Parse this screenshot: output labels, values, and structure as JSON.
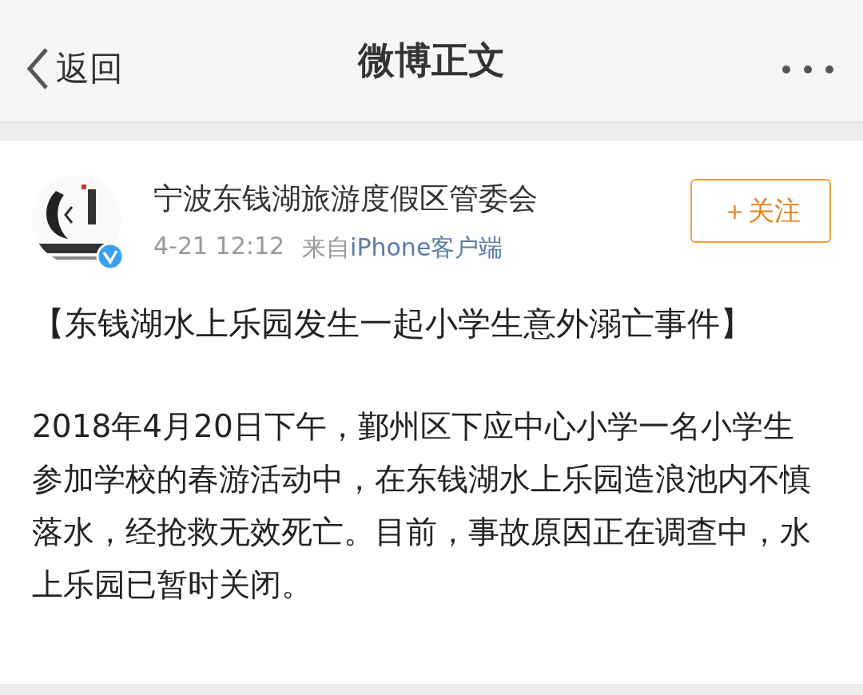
{
  "nav": {
    "back": "返回",
    "title": "微博正文"
  },
  "post": {
    "author": "宁波东钱湖旅游度假区管委会",
    "verified": true,
    "time": "4-21 12:12",
    "source_prefix": "来自",
    "source": "iPhone客户端",
    "follow_button": "＋关注",
    "headline": "【东钱湖水上乐园发生一起小学生意外溺亡事件】",
    "body": "2018年4月20日下午，鄞州区下应中心小学一名小学生参加学校的春游活动中，在东钱湖水上乐园造浪池内不慎落水，经抢救无效死亡。目前，事故原因正在调查中，水上乐园已暂时关闭。"
  }
}
